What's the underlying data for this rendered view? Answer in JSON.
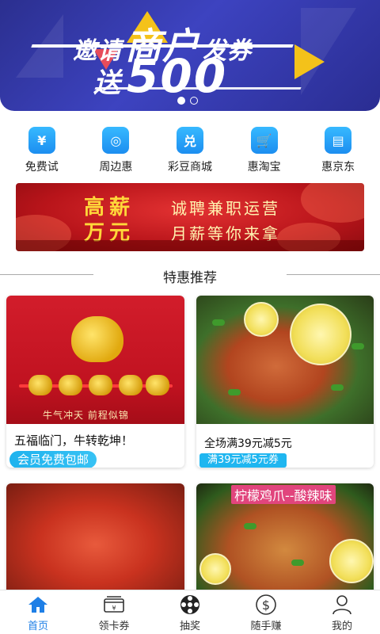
{
  "banner": {
    "line1_a": "邀请",
    "line1_big": "商户",
    "line1_b": "发券",
    "line2_a": "送",
    "line2_num": "500"
  },
  "nav": {
    "items": [
      {
        "label": "免费试",
        "icon": "yen-icon",
        "glyph": "¥"
      },
      {
        "label": "周边惠",
        "icon": "location-icon",
        "glyph": "◎"
      },
      {
        "label": "彩豆商城",
        "icon": "exchange-icon",
        "glyph": "兑"
      },
      {
        "label": "惠淘宝",
        "icon": "cart-icon",
        "glyph": "🛒"
      },
      {
        "label": "惠京东",
        "icon": "bag-icon",
        "glyph": "▤"
      }
    ]
  },
  "recruit": {
    "line_a": "高薪",
    "line_b": "万元",
    "line_c": "诚聘兼职运营",
    "line_d": "月薪等你来拿"
  },
  "section": {
    "title": "特惠推荐"
  },
  "products": [
    {
      "description": "五福临门，牛转乾坤！",
      "tag": "会员免费包邮",
      "image_caption": "牛气冲天  前程似锦"
    },
    {
      "description": "全场满39元减5元",
      "tag": "满39元减5元券"
    },
    {
      "image_caption": ""
    },
    {
      "image_caption": "柠檬鸡爪--酸辣味"
    }
  ],
  "tabbar": {
    "items": [
      {
        "label": "首页",
        "icon": "home-icon",
        "active": true
      },
      {
        "label": "领卡券",
        "icon": "card-coupon-icon",
        "active": false
      },
      {
        "label": "抽奖",
        "icon": "lottery-wheel-icon",
        "active": false
      },
      {
        "label": "随手赚",
        "icon": "dollar-coin-icon",
        "active": false
      },
      {
        "label": "我的",
        "icon": "user-icon",
        "active": false
      }
    ]
  },
  "colors": {
    "accent": "#1e7fe6",
    "tag_blue": "#1fb3ee",
    "banner_blue": "#3d43c0",
    "recruit_red": "#c8151b"
  }
}
